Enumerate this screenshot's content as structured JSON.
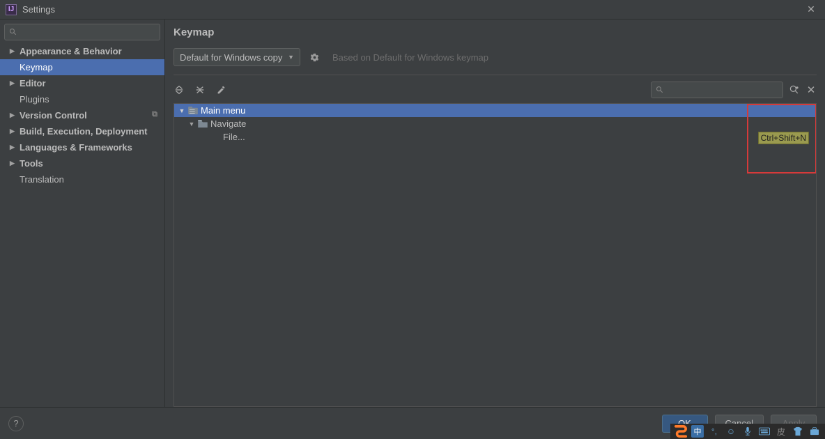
{
  "window": {
    "title": "Settings"
  },
  "sidebar": {
    "search_placeholder": "",
    "items": [
      {
        "label": "Appearance & Behavior",
        "expandable": true
      },
      {
        "label": "Keymap",
        "selected": true,
        "child": true
      },
      {
        "label": "Editor",
        "expandable": true
      },
      {
        "label": "Plugins",
        "child": true
      },
      {
        "label": "Version Control",
        "expandable": true,
        "badge": true
      },
      {
        "label": "Build, Execution, Deployment",
        "expandable": true
      },
      {
        "label": "Languages & Frameworks",
        "expandable": true
      },
      {
        "label": "Tools",
        "expandable": true
      },
      {
        "label": "Translation",
        "child": true
      }
    ]
  },
  "main": {
    "title": "Keymap",
    "scheme": "Default for Windows copy",
    "based_on": "Based on Default for Windows keymap",
    "tree": {
      "root": "Main menu",
      "node1": "Navigate",
      "leaf": "File...",
      "shortcut": "Ctrl+Shift+N"
    }
  },
  "footer": {
    "ok": "OK",
    "cancel": "Cancel",
    "apply": "Apply"
  },
  "ime": {
    "lang": "中"
  }
}
